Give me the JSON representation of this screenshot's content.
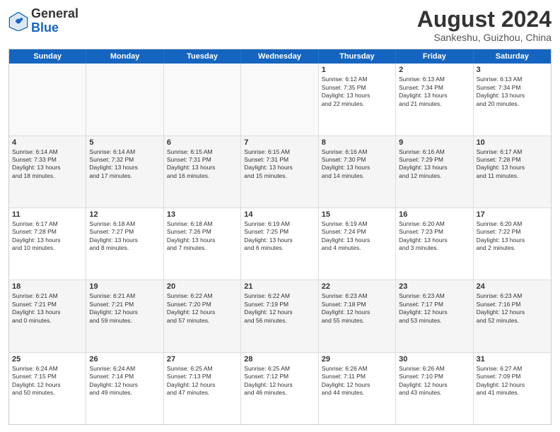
{
  "logo": {
    "general": "General",
    "blue": "Blue"
  },
  "title": {
    "month_year": "August 2024",
    "location": "Sankeshu, Guizhou, China"
  },
  "header_days": [
    "Sunday",
    "Monday",
    "Tuesday",
    "Wednesday",
    "Thursday",
    "Friday",
    "Saturday"
  ],
  "weeks": [
    [
      {
        "day": "",
        "empty": true,
        "lines": []
      },
      {
        "day": "",
        "empty": true,
        "lines": []
      },
      {
        "day": "",
        "empty": true,
        "lines": []
      },
      {
        "day": "",
        "empty": true,
        "lines": []
      },
      {
        "day": "1",
        "empty": false,
        "lines": [
          "Sunrise: 6:12 AM",
          "Sunset: 7:35 PM",
          "Daylight: 13 hours",
          "and 22 minutes."
        ]
      },
      {
        "day": "2",
        "empty": false,
        "lines": [
          "Sunrise: 6:13 AM",
          "Sunset: 7:34 PM",
          "Daylight: 13 hours",
          "and 21 minutes."
        ]
      },
      {
        "day": "3",
        "empty": false,
        "lines": [
          "Sunrise: 6:13 AM",
          "Sunset: 7:34 PM",
          "Daylight: 13 hours",
          "and 20 minutes."
        ]
      }
    ],
    [
      {
        "day": "4",
        "empty": false,
        "lines": [
          "Sunrise: 6:14 AM",
          "Sunset: 7:33 PM",
          "Daylight: 13 hours",
          "and 18 minutes."
        ]
      },
      {
        "day": "5",
        "empty": false,
        "lines": [
          "Sunrise: 6:14 AM",
          "Sunset: 7:32 PM",
          "Daylight: 13 hours",
          "and 17 minutes."
        ]
      },
      {
        "day": "6",
        "empty": false,
        "lines": [
          "Sunrise: 6:15 AM",
          "Sunset: 7:31 PM",
          "Daylight: 13 hours",
          "and 16 minutes."
        ]
      },
      {
        "day": "7",
        "empty": false,
        "lines": [
          "Sunrise: 6:15 AM",
          "Sunset: 7:31 PM",
          "Daylight: 13 hours",
          "and 15 minutes."
        ]
      },
      {
        "day": "8",
        "empty": false,
        "lines": [
          "Sunrise: 6:16 AM",
          "Sunset: 7:30 PM",
          "Daylight: 13 hours",
          "and 14 minutes."
        ]
      },
      {
        "day": "9",
        "empty": false,
        "lines": [
          "Sunrise: 6:16 AM",
          "Sunset: 7:29 PM",
          "Daylight: 13 hours",
          "and 12 minutes."
        ]
      },
      {
        "day": "10",
        "empty": false,
        "lines": [
          "Sunrise: 6:17 AM",
          "Sunset: 7:28 PM",
          "Daylight: 13 hours",
          "and 11 minutes."
        ]
      }
    ],
    [
      {
        "day": "11",
        "empty": false,
        "lines": [
          "Sunrise: 6:17 AM",
          "Sunset: 7:28 PM",
          "Daylight: 13 hours",
          "and 10 minutes."
        ]
      },
      {
        "day": "12",
        "empty": false,
        "lines": [
          "Sunrise: 6:18 AM",
          "Sunset: 7:27 PM",
          "Daylight: 13 hours",
          "and 8 minutes."
        ]
      },
      {
        "day": "13",
        "empty": false,
        "lines": [
          "Sunrise: 6:18 AM",
          "Sunset: 7:26 PM",
          "Daylight: 13 hours",
          "and 7 minutes."
        ]
      },
      {
        "day": "14",
        "empty": false,
        "lines": [
          "Sunrise: 6:19 AM",
          "Sunset: 7:25 PM",
          "Daylight: 13 hours",
          "and 6 minutes."
        ]
      },
      {
        "day": "15",
        "empty": false,
        "lines": [
          "Sunrise: 6:19 AM",
          "Sunset: 7:24 PM",
          "Daylight: 13 hours",
          "and 4 minutes."
        ]
      },
      {
        "day": "16",
        "empty": false,
        "lines": [
          "Sunrise: 6:20 AM",
          "Sunset: 7:23 PM",
          "Daylight: 13 hours",
          "and 3 minutes."
        ]
      },
      {
        "day": "17",
        "empty": false,
        "lines": [
          "Sunrise: 6:20 AM",
          "Sunset: 7:22 PM",
          "Daylight: 13 hours",
          "and 2 minutes."
        ]
      }
    ],
    [
      {
        "day": "18",
        "empty": false,
        "lines": [
          "Sunrise: 6:21 AM",
          "Sunset: 7:21 PM",
          "Daylight: 13 hours",
          "and 0 minutes."
        ]
      },
      {
        "day": "19",
        "empty": false,
        "lines": [
          "Sunrise: 6:21 AM",
          "Sunset: 7:21 PM",
          "Daylight: 12 hours",
          "and 59 minutes."
        ]
      },
      {
        "day": "20",
        "empty": false,
        "lines": [
          "Sunrise: 6:22 AM",
          "Sunset: 7:20 PM",
          "Daylight: 12 hours",
          "and 57 minutes."
        ]
      },
      {
        "day": "21",
        "empty": false,
        "lines": [
          "Sunrise: 6:22 AM",
          "Sunset: 7:19 PM",
          "Daylight: 12 hours",
          "and 56 minutes."
        ]
      },
      {
        "day": "22",
        "empty": false,
        "lines": [
          "Sunrise: 6:23 AM",
          "Sunset: 7:18 PM",
          "Daylight: 12 hours",
          "and 55 minutes."
        ]
      },
      {
        "day": "23",
        "empty": false,
        "lines": [
          "Sunrise: 6:23 AM",
          "Sunset: 7:17 PM",
          "Daylight: 12 hours",
          "and 53 minutes."
        ]
      },
      {
        "day": "24",
        "empty": false,
        "lines": [
          "Sunrise: 6:23 AM",
          "Sunset: 7:16 PM",
          "Daylight: 12 hours",
          "and 52 minutes."
        ]
      }
    ],
    [
      {
        "day": "25",
        "empty": false,
        "lines": [
          "Sunrise: 6:24 AM",
          "Sunset: 7:15 PM",
          "Daylight: 12 hours",
          "and 50 minutes."
        ]
      },
      {
        "day": "26",
        "empty": false,
        "lines": [
          "Sunrise: 6:24 AM",
          "Sunset: 7:14 PM",
          "Daylight: 12 hours",
          "and 49 minutes."
        ]
      },
      {
        "day": "27",
        "empty": false,
        "lines": [
          "Sunrise: 6:25 AM",
          "Sunset: 7:13 PM",
          "Daylight: 12 hours",
          "and 47 minutes."
        ]
      },
      {
        "day": "28",
        "empty": false,
        "lines": [
          "Sunrise: 6:25 AM",
          "Sunset: 7:12 PM",
          "Daylight: 12 hours",
          "and 46 minutes."
        ]
      },
      {
        "day": "29",
        "empty": false,
        "lines": [
          "Sunrise: 6:26 AM",
          "Sunset: 7:11 PM",
          "Daylight: 12 hours",
          "and 44 minutes."
        ]
      },
      {
        "day": "30",
        "empty": false,
        "lines": [
          "Sunrise: 6:26 AM",
          "Sunset: 7:10 PM",
          "Daylight: 12 hours",
          "and 43 minutes."
        ]
      },
      {
        "day": "31",
        "empty": false,
        "lines": [
          "Sunrise: 6:27 AM",
          "Sunset: 7:09 PM",
          "Daylight: 12 hours",
          "and 41 minutes."
        ]
      }
    ]
  ]
}
